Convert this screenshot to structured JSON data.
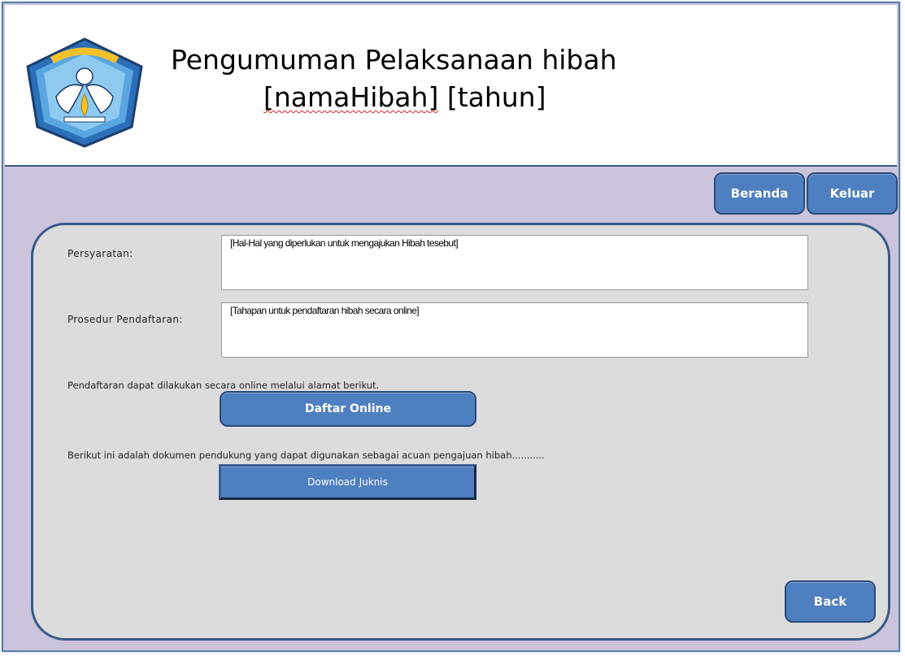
{
  "header": {
    "logo_text": "TUT WURI HANDAYANI",
    "title_line1": "Pengumuman Pelaksanaan hibah",
    "title_line2_part1": "[namaHibah]",
    "title_line2_part2": " [tahun]"
  },
  "nav": {
    "home_label": "Beranda",
    "logout_label": "Keluar"
  },
  "form": {
    "requirements_label": "Persyaratan:",
    "requirements_value": "[Hal-Hal yang diperlukan untuk mengajukan Hibah tesebut]",
    "procedure_label": "Prosedur Pendaftaran:",
    "procedure_value": "[Tahapan untuk pendaftaran hibah secara online]"
  },
  "online": {
    "info_text": "Pendaftaran dapat dilakukan secara online melalui alamat berikut.",
    "button_label": "Daftar Online"
  },
  "documents": {
    "info_text": "Berikut ini adalah dokumen pendukung yang dapat digunakan sebagai acuan pengajuan hibah...........",
    "button_label": "Download Juknis"
  },
  "footer": {
    "back_label": "Back"
  },
  "colors": {
    "button_fill": "#4e7fc0",
    "button_border": "#2b4b78",
    "background": "#cbc4dc",
    "panel": "#dcdcdc"
  }
}
